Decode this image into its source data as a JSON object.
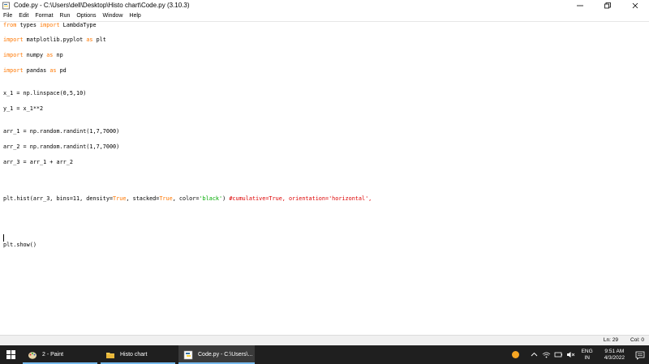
{
  "window": {
    "title": "Code.py - C:\\Users\\dell\\Desktop\\Histo chart\\Code.py (3.10.3)",
    "controls": [
      "minimize",
      "maximize",
      "close"
    ]
  },
  "menu": [
    "File",
    "Edit",
    "Format",
    "Run",
    "Options",
    "Window",
    "Help"
  ],
  "code": {
    "line1_kw1": "from",
    "line1_mid": " types ",
    "line1_kw2": "import",
    "line1_end": " LambdaType",
    "line2_kw1": "import",
    "line2_mid": " matplotlib.pyplot ",
    "line2_kw2": "as",
    "line2_end": " plt",
    "line3_kw1": "import",
    "line3_mid": " numpy ",
    "line3_kw2": "as",
    "line3_end": " np",
    "line4_kw1": "import",
    "line4_mid": " pandas ",
    "line4_kw2": "as",
    "line4_end": " pd",
    "line5": "x_1 = np.linspace(0,5,10)",
    "line6": "y_1 = x_1**2",
    "line7": "arr_1 = np.random.randint(1,7,7000)",
    "line8": "arr_2 = np.random.randint(1,7,7000)",
    "line9": "arr_3 = arr_1 + arr_2",
    "line10_a": "plt.hist(arr_3, bins=11, density=",
    "line10_true1": "True",
    "line10_b": ", stacked=",
    "line10_true2": "True",
    "line10_c": ", color=",
    "line10_str": "'black'",
    "line10_d": ") ",
    "line10_cmt": "#cumulative=True, orientation='horizontal',",
    "line11": "plt.show()"
  },
  "status": {
    "ln": "Ln: 29",
    "col": "Col: 0"
  },
  "taskbar": {
    "items": [
      {
        "label": "2 - Paint",
        "icon": "paint-icon"
      },
      {
        "label": "Histo chart",
        "icon": "folder-icon"
      },
      {
        "label": "Code.py - C:\\Users\\...",
        "icon": "python-idle-icon"
      }
    ],
    "lang_top": "ENG",
    "lang_bottom": "IN",
    "time": "9:51 AM",
    "date": "4/3/2022"
  },
  "colors": {
    "keyword": "#ff7700",
    "string": "#00aa00",
    "comment": "#dd0000",
    "taskbar": "#1f1f1f",
    "accent": "#76b9ed"
  }
}
